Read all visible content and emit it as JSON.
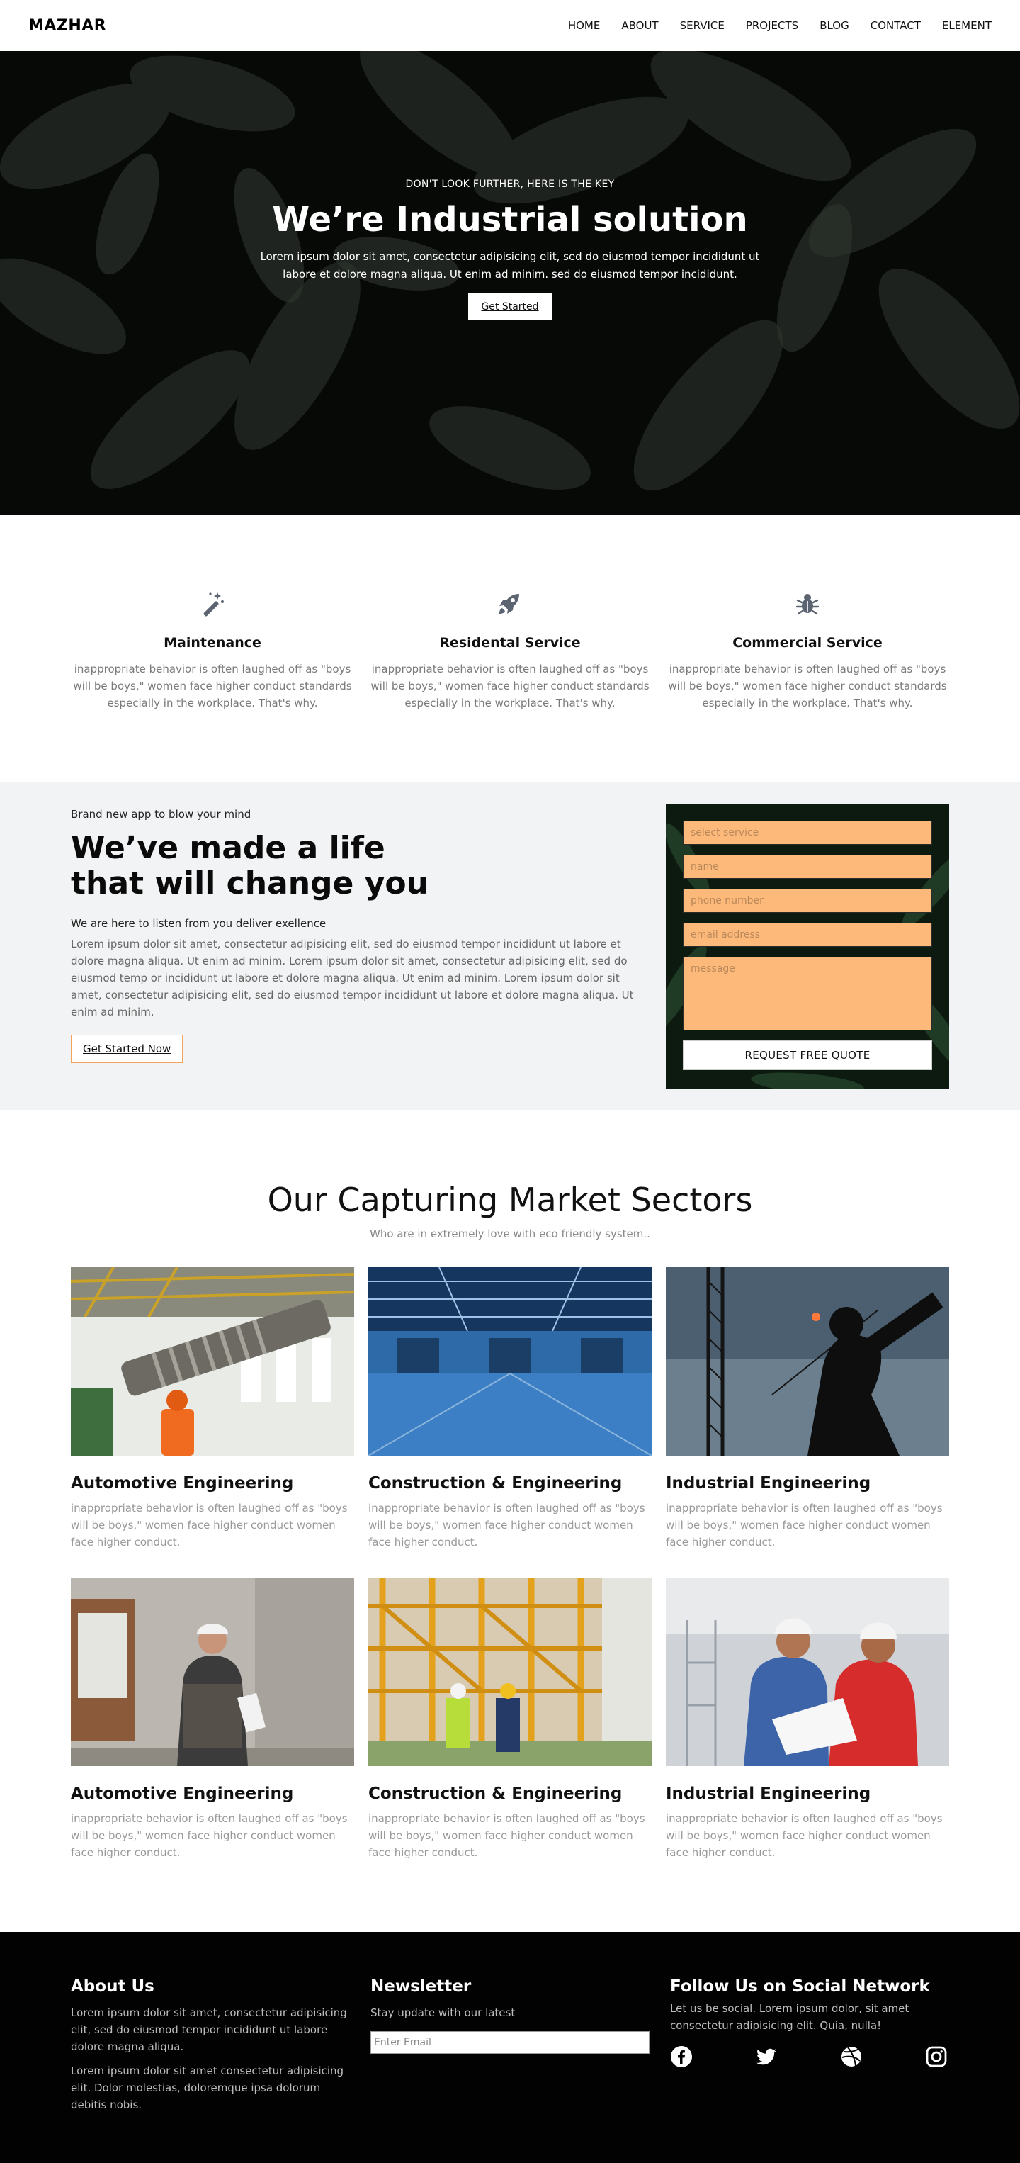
{
  "nav": {
    "logo": "MAZHAR",
    "items": [
      "HOME",
      "ABOUT",
      "SERVICE",
      "PROJECTS",
      "BLOG",
      "CONTACT",
      "ELEMENT"
    ]
  },
  "hero": {
    "eyebrow": "DON'T LOOK FURTHER, HERE IS THE KEY",
    "title": "We’re Industrial solution",
    "text": "Lorem ipsum dolor sit amet, consectetur adipisicing elit, sed do eiusmod tempor incididunt ut labore et dolore magna aliqua. Ut enim ad minim. sed do eiusmod tempor incididunt.",
    "button": "Get Started"
  },
  "features": [
    {
      "icon": "magic-wand-icon",
      "title": "Maintenance",
      "text": "inappropriate behavior is often laughed off as \"boys will be boys,\" women face higher conduct standards especially in the workplace. That's why."
    },
    {
      "icon": "rocket-icon",
      "title": "Residental Service",
      "text": "inappropriate behavior is often laughed off as \"boys will be boys,\" women face higher conduct standards especially in the workplace. That's why."
    },
    {
      "icon": "bug-icon",
      "title": "Commercial Service",
      "text": "inappropriate behavior is often laughed off as \"boys will be boys,\" women face higher conduct standards especially in the workplace. That's why."
    }
  ],
  "about": {
    "eyebrow": "Brand new app to blow your mind",
    "title": "We’ve made a life that will change you",
    "subtitle": "We are here to listen from you deliver exellence",
    "text": "Lorem ipsum dolor sit amet, consectetur adipisicing elit, sed do eiusmod tempor incididunt ut labore et dolore magna aliqua. Ut enim ad minim. Lorem ipsum dolor sit amet, consectetur adipisicing elit, sed do eiusmod temp or incididunt ut labore et dolore magna aliqua. Ut enim ad minim. Lorem ipsum dolor sit amet, consectetur adipisicing elit, sed do eiusmod tempor incididunt ut labore et dolore magna aliqua. Ut enim ad minim.",
    "button": "Get Started Now"
  },
  "quote": {
    "service_placeholder": "select service",
    "name_placeholder": "name",
    "phone_placeholder": "phone number",
    "email_placeholder": "email address",
    "message_placeholder": "message",
    "button": "REQUEST FREE QUOTE"
  },
  "sectors": {
    "title": "Our Capturing Market Sectors",
    "subtitle": "Who are in extremely love with eco friendly system..",
    "cards": [
      {
        "title": "Automotive Engineering",
        "text": "inappropriate behavior is often laughed off as \"boys will be boys,\" women face higher conduct women face higher conduct."
      },
      {
        "title": "Construction & Engineering",
        "text": "inappropriate behavior is often laughed off as \"boys will be boys,\" women face higher conduct women face higher conduct."
      },
      {
        "title": "Industrial Engineering",
        "text": "inappropriate behavior is often laughed off as \"boys will be boys,\" women face higher conduct women face higher conduct."
      },
      {
        "title": "Automotive Engineering",
        "text": "inappropriate behavior is often laughed off as \"boys will be boys,\" women face higher conduct women face higher conduct."
      },
      {
        "title": "Construction & Engineering",
        "text": "inappropriate behavior is often laughed off as \"boys will be boys,\" women face higher conduct women face higher conduct."
      },
      {
        "title": "Industrial Engineering",
        "text": "inappropriate behavior is often laughed off as \"boys will be boys,\" women face higher conduct women face higher conduct."
      }
    ]
  },
  "footer": {
    "about_title": "About Us",
    "about_text_1": "Lorem ipsum dolor sit amet, consectetur adipisicing elit, sed do eiusmod tempor incididunt ut labore dolore magna aliqua.",
    "about_text_2": "Lorem ipsum dolor sit amet consectetur adipisicing elit. Dolor molestias, doloremque ipsa dolorum debitis nobis.",
    "newsletter_title": "Newsletter",
    "newsletter_text": "Stay update with our latest",
    "email_placeholder": "Enter Email",
    "social_title": "Follow Us on Social Network",
    "social_text": "Let us be social. Lorem ipsum dolor, sit amet consectetur adipisicing elit. Quia, nulla!",
    "socials": [
      "facebook-icon",
      "twitter-icon",
      "dribbble-icon",
      "instagram-icon"
    ]
  },
  "colors": {
    "accent": "#fdb97a",
    "accent_border": "#f5a35b",
    "footer_bg": "#020202",
    "about_bg": "#f2f3f4"
  }
}
